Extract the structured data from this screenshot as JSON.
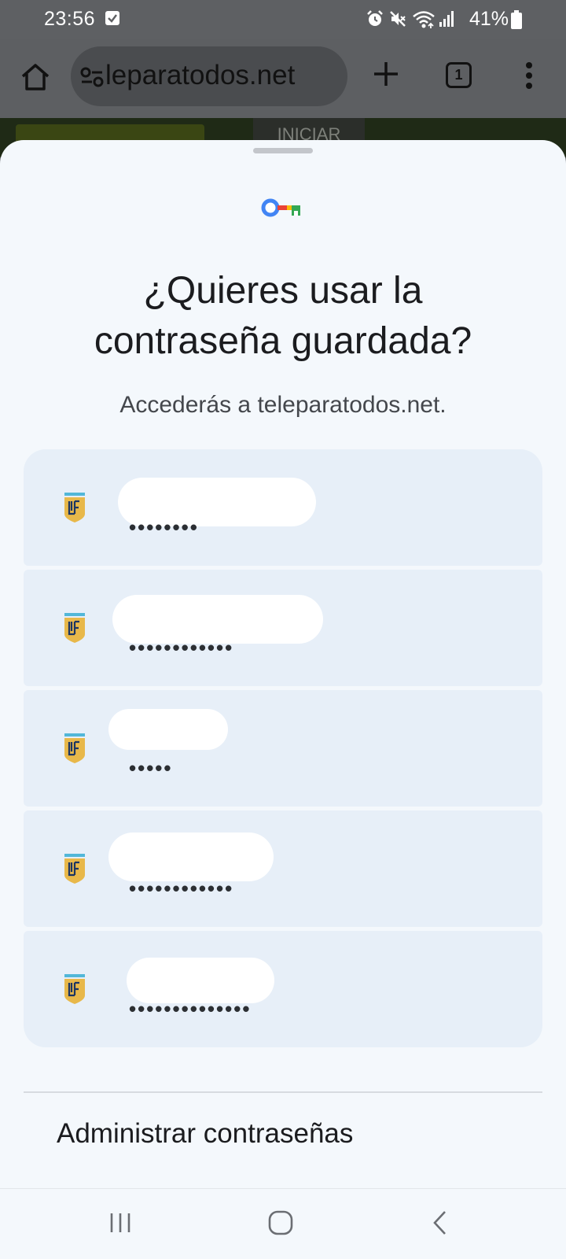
{
  "status_bar": {
    "time": "23:56",
    "battery": "41%",
    "icons": [
      "check-icon",
      "alarm-icon",
      "mute-icon",
      "wifi-icon",
      "signal-icon",
      "battery-icon"
    ]
  },
  "browser": {
    "url": "teleparatodos.net",
    "url_visible": "leparatodos.net",
    "tab_count": "1",
    "page_peek_label": "INICIAR",
    "icons": [
      "home-icon",
      "site-info-icon",
      "plus-icon",
      "tabs-icon",
      "menu-icon"
    ]
  },
  "sheet": {
    "title": "¿Quieres usar la contraseña guardada?",
    "subtitle": "Accederás a teleparatodos.net.",
    "accounts": [
      {
        "username_hidden": true,
        "password_mask": "••••••••"
      },
      {
        "username_hidden": true,
        "password_mask": "••••••••••••"
      },
      {
        "username_hidden": true,
        "password_mask": "•••••"
      },
      {
        "username_hidden": true,
        "password_mask": "••••••••••••"
      },
      {
        "username_hidden": true,
        "password_mask": "••••••••••••••"
      }
    ],
    "manage_label": "Administrar contraseñas"
  },
  "colors": {
    "scrim": "#5d5f62",
    "sheet_bg": "#f4f8fc",
    "row_bg": "#e7eff8",
    "key_blue": "#4285f4",
    "key_red": "#ea4335",
    "key_yellow": "#fbbc04",
    "key_green": "#34a853",
    "shield_gold": "#e8b84a"
  },
  "navbar": {
    "icons": [
      "recents-icon",
      "home-nav-icon",
      "back-icon"
    ]
  }
}
